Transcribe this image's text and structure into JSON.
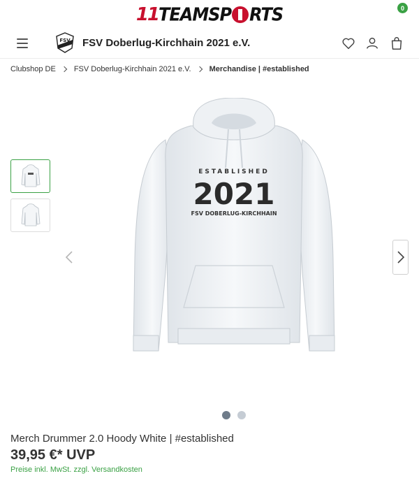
{
  "brand": {
    "prefix": "11",
    "name_a": "TEAMSP",
    "name_b": "RTS"
  },
  "header": {
    "club_name": "FSV Doberlug-Kirchhain 2021 e.V.",
    "cart_count": "0"
  },
  "breadcrumb": [
    {
      "label": "Clubshop DE"
    },
    {
      "label": "FSV Doberlug-Kirchhain 2021 e.V."
    },
    {
      "label": "Merchandise | #established"
    }
  ],
  "print": {
    "line1": "ESTABLISHED",
    "year": "2021",
    "line2": "FSV DOBERLUG-KIRCHHAIN"
  },
  "club_logo_text": "FSV",
  "product": {
    "title": "Merch Drummer 2.0 Hoody White | #established",
    "price": "39,95 €* UVP",
    "tax_note": "Preise inkl. MwSt. zzgl. Versandkosten"
  },
  "gallery": {
    "image_count": 2,
    "active_index": 1
  },
  "colors": {
    "accent_green": "#3aa144",
    "brand_red": "#c8102e"
  }
}
